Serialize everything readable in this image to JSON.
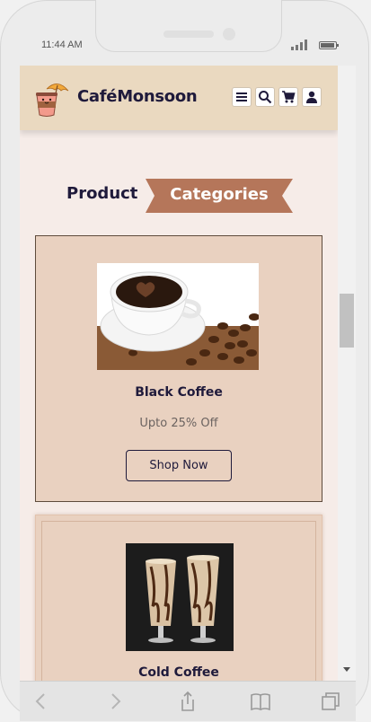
{
  "status_bar": {
    "time": "11:44 AM"
  },
  "header": {
    "brand": "CaféMonsoon",
    "icons": [
      "menu-icon",
      "search-icon",
      "cart-icon",
      "user-icon"
    ]
  },
  "section": {
    "title_part1": "Product",
    "title_part2": "Categories"
  },
  "categories": [
    {
      "title": "Black Coffee",
      "subtitle": "Upto 25% Off",
      "button_label": "Shop Now"
    },
    {
      "title": "Cold Coffee"
    }
  ],
  "toolbar": {
    "icons": [
      "back-icon",
      "forward-icon",
      "share-icon",
      "bookmarks-icon",
      "tabs-icon"
    ]
  },
  "colors": {
    "header_bg": "#ead9c0",
    "page_bg": "#f6ece8",
    "card_bg": "#e9d1c0",
    "accent": "#b5765a",
    "text_dark": "#1f1a3b"
  }
}
